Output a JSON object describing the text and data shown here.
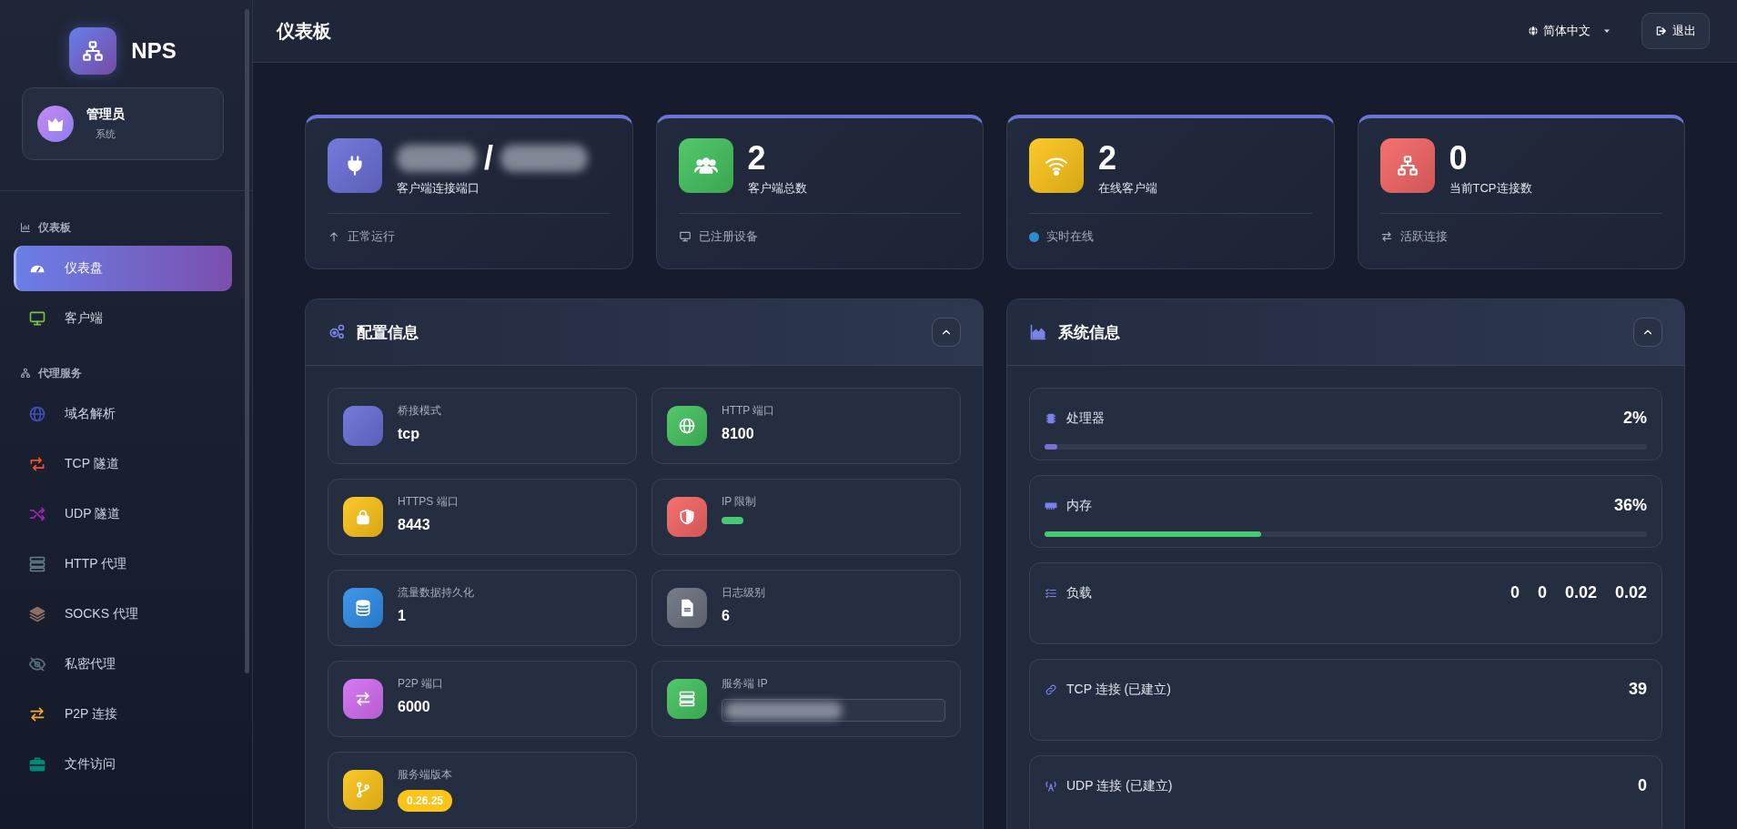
{
  "brand": {
    "name": "NPS"
  },
  "user": {
    "name": "管理员",
    "role": "系统"
  },
  "sidebar": {
    "sections": [
      {
        "label": "仪表板",
        "items": [
          {
            "label": "仪表盘",
            "selected": true,
            "color": "#ffffff"
          },
          {
            "label": "客户端",
            "selected": false,
            "color": "#7cc242"
          }
        ]
      },
      {
        "label": "代理服务",
        "items": [
          {
            "label": "域名解析",
            "selected": false,
            "color": "#3f51b5"
          },
          {
            "label": "TCP 隧道",
            "selected": false,
            "color": "#f4511e"
          },
          {
            "label": "UDP 隧道",
            "selected": false,
            "color": "#9c27b0"
          },
          {
            "label": "HTTP 代理",
            "selected": false,
            "color": "#607d8b"
          },
          {
            "label": "SOCKS 代理",
            "selected": false,
            "color": "#8d6e63"
          },
          {
            "label": "私密代理",
            "selected": false,
            "color": "#546e7a"
          },
          {
            "label": "P2P 连接",
            "selected": false,
            "color": "#f9a825"
          },
          {
            "label": "文件访问",
            "selected": false,
            "color": "#00897b"
          }
        ]
      }
    ]
  },
  "header": {
    "title": "仪表板",
    "language": "简体中文",
    "logout": "退出"
  },
  "stats": [
    {
      "value": "/",
      "redacted": true,
      "label": "客户端连接端口",
      "footer": "正常运行",
      "color": "#6a6fd8"
    },
    {
      "value": "2",
      "redacted": false,
      "label": "客户端总数",
      "footer": "已注册设备",
      "color": "#44c35f"
    },
    {
      "value": "2",
      "redacted": false,
      "label": "在线客户端",
      "footer": "实时在线",
      "color": "#fcc419"
    },
    {
      "value": "0",
      "redacted": false,
      "label": "当前TCP连接数",
      "footer": "活跃连接",
      "color": "#f56565"
    }
  ],
  "config": {
    "title": "配置信息",
    "expanded": true,
    "items": [
      {
        "kind": "text",
        "label": "桥接模式",
        "value": "tcp",
        "color": "#6a6fd8"
      },
      {
        "kind": "text",
        "label": "HTTP 端口",
        "value": "8100",
        "color": "#44c35f"
      },
      {
        "kind": "text",
        "label": "HTTPS 端口",
        "value": "8443",
        "color": "#fcc419"
      },
      {
        "kind": "toggle",
        "label": "IP 限制",
        "on": true,
        "color": "#f56565"
      },
      {
        "kind": "text",
        "label": "流量数据持久化",
        "value": "1",
        "color": "#2f8ee8"
      },
      {
        "kind": "text",
        "label": "日志级别",
        "value": "6",
        "color": "#6c737f"
      },
      {
        "kind": "text",
        "label": "P2P 端口",
        "value": "6000",
        "color": "#d36ef2"
      },
      {
        "kind": "field",
        "label": "服务端 IP",
        "redacted": true,
        "color": "#44c35f"
      },
      {
        "kind": "badge",
        "label": "服务端版本",
        "value": "0.26.25",
        "color": "#fcc419"
      }
    ]
  },
  "system": {
    "title": "系统信息",
    "expanded": true,
    "rows": [
      {
        "kind": "meter",
        "label": "处理器",
        "value": "2%",
        "level": 0.02,
        "color": "#7c6fd6"
      },
      {
        "kind": "meter",
        "label": "内存",
        "value": "36%",
        "level": 0.36,
        "color": "#48c774"
      },
      {
        "kind": "values",
        "label": "负载",
        "values": [
          "0",
          "0",
          "0.02",
          "0.02"
        ]
      },
      {
        "kind": "value",
        "label": "TCP 连接 (已建立)",
        "value": "39"
      },
      {
        "kind": "value",
        "label": "UDP 连接 (已建立)",
        "value": "0"
      }
    ]
  }
}
